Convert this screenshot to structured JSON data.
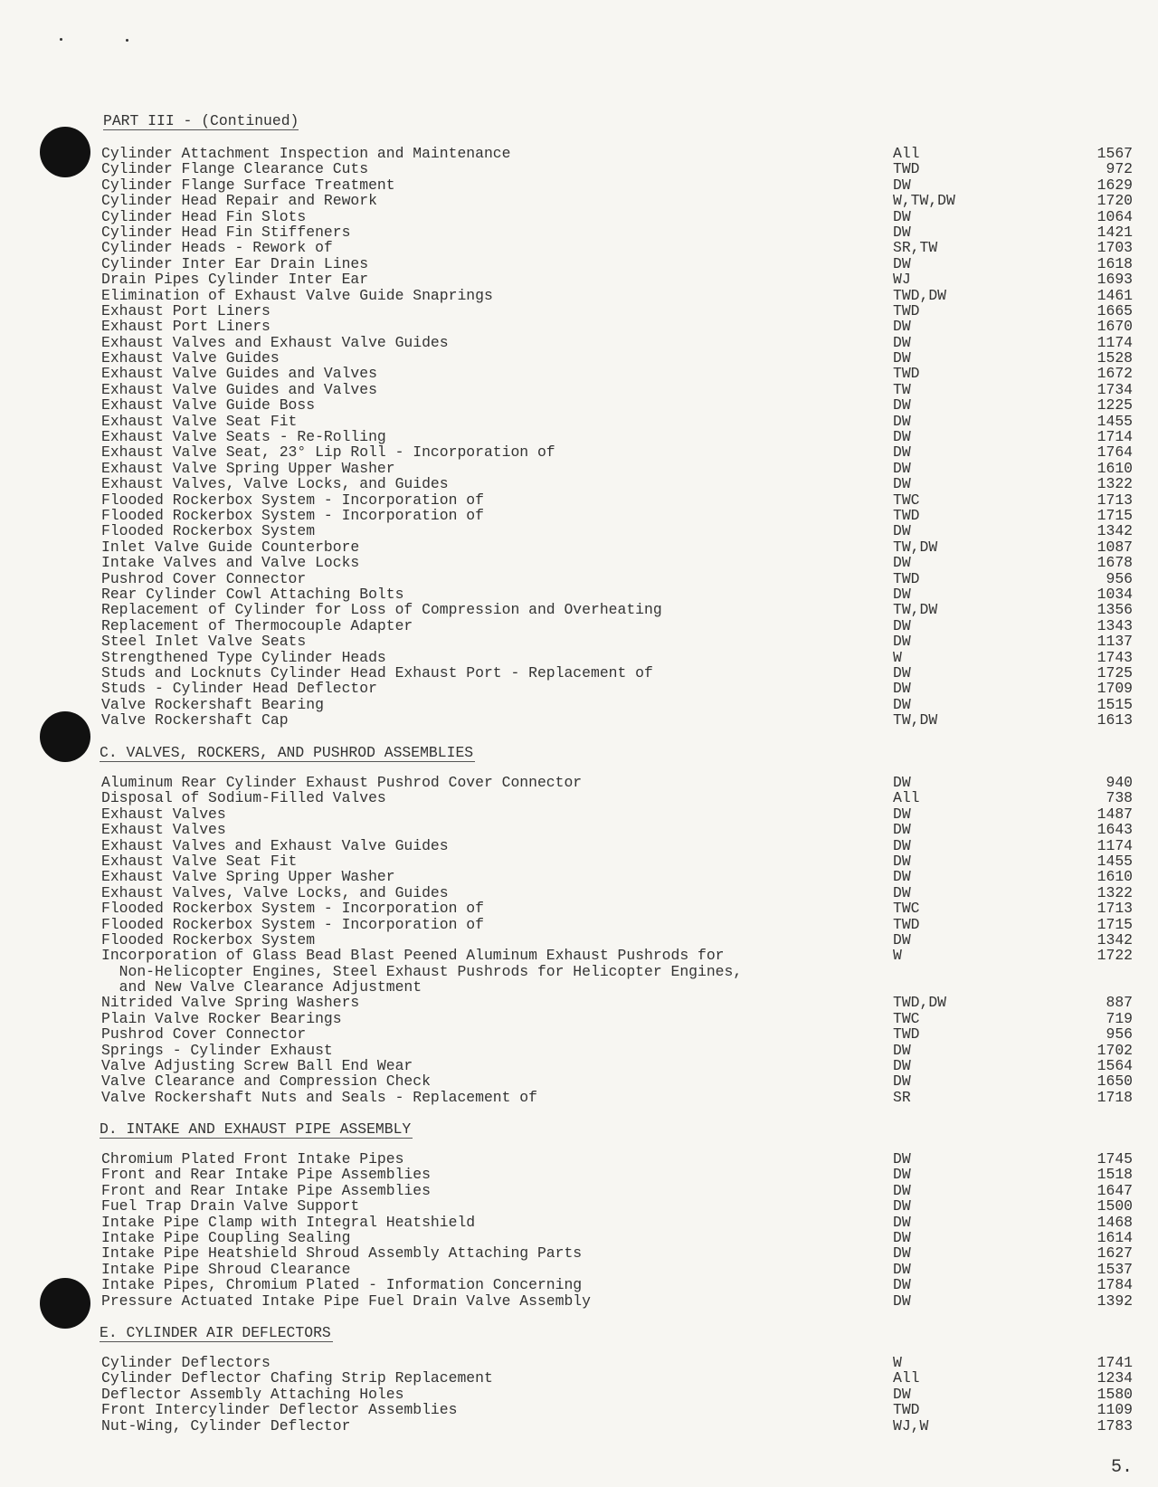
{
  "part_header": "PART III - (Continued)",
  "page_number": "5.",
  "sections": [
    {
      "heading": "",
      "rows": [
        {
          "title": [
            "Cylinder Attachment Inspection and Maintenance"
          ],
          "code": "All",
          "num": "1567"
        },
        {
          "title": [
            "Cylinder Flange Clearance Cuts"
          ],
          "code": "TWD",
          "num": "972"
        },
        {
          "title": [
            "Cylinder Flange Surface Treatment"
          ],
          "code": "DW",
          "num": "1629"
        },
        {
          "title": [
            "Cylinder Head Repair and Rework"
          ],
          "code": "W,TW,DW",
          "num": "1720"
        },
        {
          "title": [
            "Cylinder Head Fin Slots"
          ],
          "code": "DW",
          "num": "1064"
        },
        {
          "title": [
            "Cylinder Head Fin Stiffeners"
          ],
          "code": "DW",
          "num": "1421"
        },
        {
          "title": [
            "Cylinder Heads - Rework of"
          ],
          "code": "SR,TW",
          "num": "1703"
        },
        {
          "title": [
            "Cylinder Inter Ear Drain Lines"
          ],
          "code": "DW",
          "num": "1618"
        },
        {
          "title": [
            "Drain Pipes Cylinder Inter Ear"
          ],
          "code": "WJ",
          "num": "1693"
        },
        {
          "title": [
            "Elimination of Exhaust Valve Guide Snaprings"
          ],
          "code": "TWD,DW",
          "num": "1461"
        },
        {
          "title": [
            "Exhaust Port Liners"
          ],
          "code": "TWD",
          "num": "1665"
        },
        {
          "title": [
            "Exhaust Port Liners"
          ],
          "code": "DW",
          "num": "1670"
        },
        {
          "title": [
            "Exhaust Valves and Exhaust Valve Guides"
          ],
          "code": "DW",
          "num": "1174"
        },
        {
          "title": [
            "Exhaust Valve Guides"
          ],
          "code": "DW",
          "num": "1528"
        },
        {
          "title": [
            "Exhaust Valve Guides and Valves"
          ],
          "code": "TWD",
          "num": "1672"
        },
        {
          "title": [
            "Exhaust Valve Guides and Valves"
          ],
          "code": "TW",
          "num": "1734"
        },
        {
          "title": [
            "Exhaust Valve Guide Boss"
          ],
          "code": "DW",
          "num": "1225"
        },
        {
          "title": [
            "Exhaust Valve Seat Fit"
          ],
          "code": "DW",
          "num": "1455"
        },
        {
          "title": [
            "Exhaust Valve Seats - Re-Rolling"
          ],
          "code": "DW",
          "num": "1714"
        },
        {
          "title": [
            "Exhaust Valve Seat, 23° Lip Roll - Incorporation of"
          ],
          "code": "DW",
          "num": "1764"
        },
        {
          "title": [
            "Exhaust Valve Spring Upper Washer"
          ],
          "code": "DW",
          "num": "1610"
        },
        {
          "title": [
            "Exhaust Valves, Valve Locks, and Guides"
          ],
          "code": "DW",
          "num": "1322"
        },
        {
          "title": [
            "Flooded Rockerbox System - Incorporation of"
          ],
          "code": "TWC",
          "num": "1713"
        },
        {
          "title": [
            "Flooded Rockerbox System - Incorporation of"
          ],
          "code": "TWD",
          "num": "1715"
        },
        {
          "title": [
            "Flooded Rockerbox System"
          ],
          "code": "DW",
          "num": "1342"
        },
        {
          "title": [
            "Inlet Valve Guide Counterbore"
          ],
          "code": "TW,DW",
          "num": "1087"
        },
        {
          "title": [
            "Intake Valves and Valve Locks"
          ],
          "code": "DW",
          "num": "1678"
        },
        {
          "title": [
            "Pushrod Cover Connector"
          ],
          "code": "TWD",
          "num": "956"
        },
        {
          "title": [
            "Rear Cylinder Cowl Attaching Bolts"
          ],
          "code": "DW",
          "num": "1034"
        },
        {
          "title": [
            "Replacement of Cylinder for Loss of Compression and Overheating"
          ],
          "code": "TW,DW",
          "num": "1356"
        },
        {
          "title": [
            "Replacement of Thermocouple Adapter"
          ],
          "code": "DW",
          "num": "1343"
        },
        {
          "title": [
            "Steel Inlet Valve Seats"
          ],
          "code": "DW",
          "num": "1137"
        },
        {
          "title": [
            "Strengthened Type Cylinder Heads"
          ],
          "code": "W",
          "num": "1743"
        },
        {
          "title": [
            "Studs and Locknuts Cylinder Head Exhaust Port - Replacement of"
          ],
          "code": "DW",
          "num": "1725"
        },
        {
          "title": [
            "Studs - Cylinder Head Deflector"
          ],
          "code": "DW",
          "num": "1709"
        },
        {
          "title": [
            "Valve Rockershaft Bearing"
          ],
          "code": "DW",
          "num": "1515"
        },
        {
          "title": [
            "Valve Rockershaft Cap"
          ],
          "code": "TW,DW",
          "num": "1613"
        }
      ]
    },
    {
      "heading": "C.  VALVES, ROCKERS, AND PUSHROD ASSEMBLIES",
      "rows": [
        {
          "title": [
            "Aluminum Rear Cylinder Exhaust Pushrod Cover Connector"
          ],
          "code": "DW",
          "num": "940"
        },
        {
          "title": [
            "Disposal of Sodium-Filled Valves"
          ],
          "code": "All",
          "num": "738"
        },
        {
          "title": [
            "Exhaust Valves"
          ],
          "code": "DW",
          "num": "1487"
        },
        {
          "title": [
            "Exhaust Valves"
          ],
          "code": "DW",
          "num": "1643"
        },
        {
          "title": [
            "Exhaust Valves and Exhaust Valve Guides"
          ],
          "code": "DW",
          "num": "1174"
        },
        {
          "title": [
            "Exhaust Valve Seat Fit"
          ],
          "code": "DW",
          "num": "1455"
        },
        {
          "title": [
            "Exhaust Valve Spring Upper Washer"
          ],
          "code": "DW",
          "num": "1610"
        },
        {
          "title": [
            "Exhaust Valves, Valve Locks, and Guides"
          ],
          "code": "DW",
          "num": "1322"
        },
        {
          "title": [
            "Flooded Rockerbox System - Incorporation of"
          ],
          "code": "TWC",
          "num": "1713"
        },
        {
          "title": [
            "Flooded Rockerbox System - Incorporation of"
          ],
          "code": "TWD",
          "num": "1715"
        },
        {
          "title": [
            "Flooded Rockerbox System"
          ],
          "code": "DW",
          "num": "1342"
        },
        {
          "title": [
            "Incorporation of Glass Bead Blast Peened Aluminum Exhaust Pushrods for",
            "  Non-Helicopter Engines, Steel Exhaust Pushrods for Helicopter Engines,",
            "  and New Valve Clearance Adjustment"
          ],
          "code": "W",
          "num": "1722"
        },
        {
          "title": [
            "Nitrided Valve Spring Washers"
          ],
          "code": "TWD,DW",
          "num": "887"
        },
        {
          "title": [
            "Plain Valve Rocker Bearings"
          ],
          "code": "TWC",
          "num": "719"
        },
        {
          "title": [
            "Pushrod Cover Connector"
          ],
          "code": "TWD",
          "num": "956"
        },
        {
          "title": [
            "Springs - Cylinder Exhaust"
          ],
          "code": "DW",
          "num": "1702"
        },
        {
          "title": [
            "Valve Adjusting Screw Ball End Wear"
          ],
          "code": "DW",
          "num": "1564"
        },
        {
          "title": [
            "Valve Clearance and Compression Check"
          ],
          "code": "DW",
          "num": "1650"
        },
        {
          "title": [
            "Valve Rockershaft Nuts and Seals - Replacement of"
          ],
          "code": "SR",
          "num": "1718"
        }
      ]
    },
    {
      "heading": "D.  INTAKE AND EXHAUST PIPE ASSEMBLY",
      "rows": [
        {
          "title": [
            "Chromium Plated Front Intake Pipes"
          ],
          "code": "DW",
          "num": "1745"
        },
        {
          "title": [
            "Front and Rear Intake Pipe Assemblies"
          ],
          "code": "DW",
          "num": "1518"
        },
        {
          "title": [
            "Front and Rear Intake Pipe Assemblies"
          ],
          "code": "DW",
          "num": "1647"
        },
        {
          "title": [
            "Fuel Trap Drain Valve Support"
          ],
          "code": "DW",
          "num": "1500"
        },
        {
          "title": [
            "Intake Pipe Clamp with Integral Heatshield"
          ],
          "code": "DW",
          "num": "1468"
        },
        {
          "title": [
            "Intake Pipe Coupling Sealing"
          ],
          "code": "DW",
          "num": "1614"
        },
        {
          "title": [
            "Intake Pipe Heatshield Shroud Assembly Attaching Parts"
          ],
          "code": "DW",
          "num": "1627"
        },
        {
          "title": [
            "Intake Pipe Shroud Clearance"
          ],
          "code": "DW",
          "num": "1537"
        },
        {
          "title": [
            "Intake Pipes, Chromium Plated - Information Concerning"
          ],
          "code": "DW",
          "num": "1784"
        },
        {
          "title": [
            "Pressure Actuated Intake Pipe Fuel Drain Valve Assembly"
          ],
          "code": "DW",
          "num": "1392"
        }
      ]
    },
    {
      "heading": "E.  CYLINDER AIR DEFLECTORS",
      "rows": [
        {
          "title": [
            "Cylinder Deflectors"
          ],
          "code": "W",
          "num": "1741"
        },
        {
          "title": [
            "Cylinder Deflector Chafing Strip Replacement"
          ],
          "code": "All",
          "num": "1234"
        },
        {
          "title": [
            "Deflector Assembly Attaching Holes"
          ],
          "code": "DW",
          "num": "1580"
        },
        {
          "title": [
            "Front Intercylinder Deflector Assemblies"
          ],
          "code": "TWD",
          "num": "1109"
        },
        {
          "title": [
            "Nut-Wing, Cylinder Deflector"
          ],
          "code": "WJ,W",
          "num": "1783"
        }
      ]
    }
  ]
}
